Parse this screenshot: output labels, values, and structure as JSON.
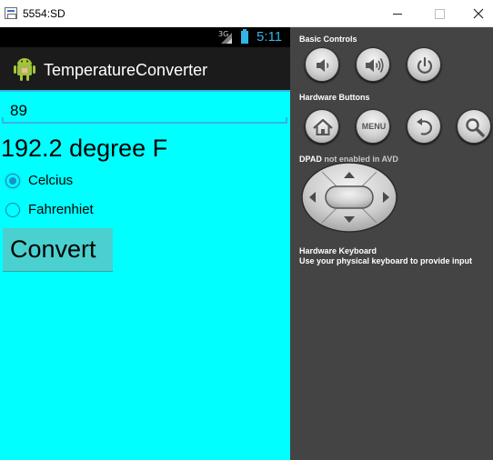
{
  "window": {
    "title": "5554:SD",
    "icons": [
      "window-app-icon",
      "minimize-icon",
      "maximize-icon",
      "close-icon"
    ]
  },
  "statusbar": {
    "network": "3G",
    "time": "5:11",
    "accent_color": "#33b5e5"
  },
  "app": {
    "title": "TemperatureConverter",
    "background_color": "#00ffff"
  },
  "form": {
    "input_value": "89",
    "result": "192.2 degree F",
    "radio_celsius_label": "Celcius",
    "radio_celsius_checked": true,
    "radio_fahrenheit_label": "Fahrenhiet",
    "radio_fahrenheit_checked": false,
    "convert_label": "Convert"
  },
  "controls": {
    "basic_controls_title": "Basic Controls",
    "hardware_buttons_title": "Hardware Buttons",
    "menu_label": "MENU",
    "dpad_title": "DPAD",
    "dpad_note": "not enabled in AVD",
    "keyboard_title": "Hardware Keyboard",
    "keyboard_note": "Use your physical keyboard to provide input",
    "button_icons": [
      "volume-down-icon",
      "volume-up-icon",
      "power-icon",
      "home-icon",
      "menu-button",
      "back-icon",
      "search-icon",
      "dpad"
    ]
  }
}
